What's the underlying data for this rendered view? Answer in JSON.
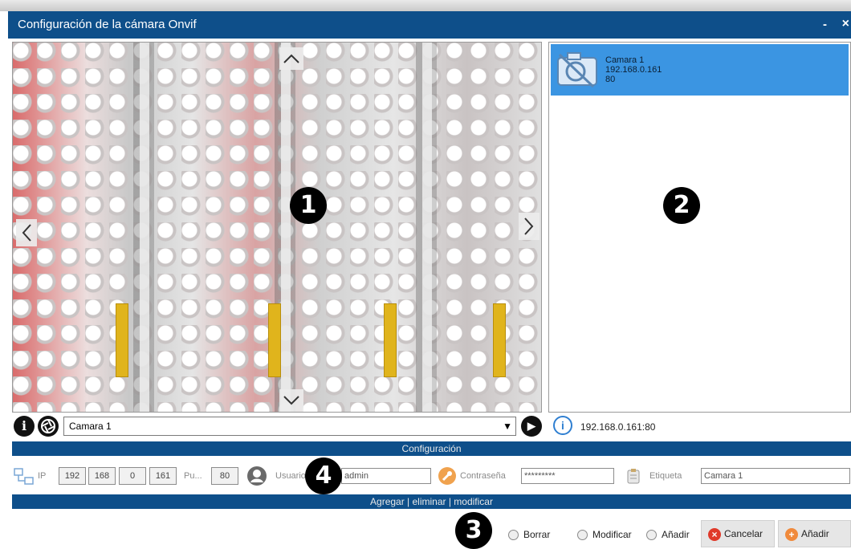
{
  "window": {
    "title": "Configuración de la cámara Onvif",
    "minimize_label": "-",
    "close_label": "×"
  },
  "badges": [
    "1",
    "2",
    "3",
    "4"
  ],
  "camera_list": {
    "items": [
      {
        "name": "Camara 1",
        "ip": "192.168.0.161",
        "port": "80"
      }
    ]
  },
  "controls": {
    "info_label": "i",
    "camera_select_value": "Camara 1",
    "play_label": "▶",
    "connection_info": "192.168.0.161:80"
  },
  "config": {
    "section_title": "Configuración",
    "ip_label": "IP",
    "ip_octets": [
      "192",
      "168",
      "0",
      "161"
    ],
    "port_label": "Pu...",
    "port_value": "80",
    "user_label": "Usuario",
    "user_value": "admin",
    "password_label": "Contraseña",
    "password_value": "*********",
    "tag_label": "Etiqueta",
    "tag_value": "Camara 1"
  },
  "actions": {
    "section_title": "Agregar | eliminar | modificar",
    "radio_delete": "Borrar",
    "radio_modify": "Modificar",
    "radio_add": "Añadir",
    "cancel_button": "Cancelar",
    "add_button": "Añadir"
  },
  "colors": {
    "titlebar": "#0e4f8a",
    "selection": "#3b95e2",
    "cancel_red": "#e03a2a",
    "add_orange": "#f08a3c"
  }
}
